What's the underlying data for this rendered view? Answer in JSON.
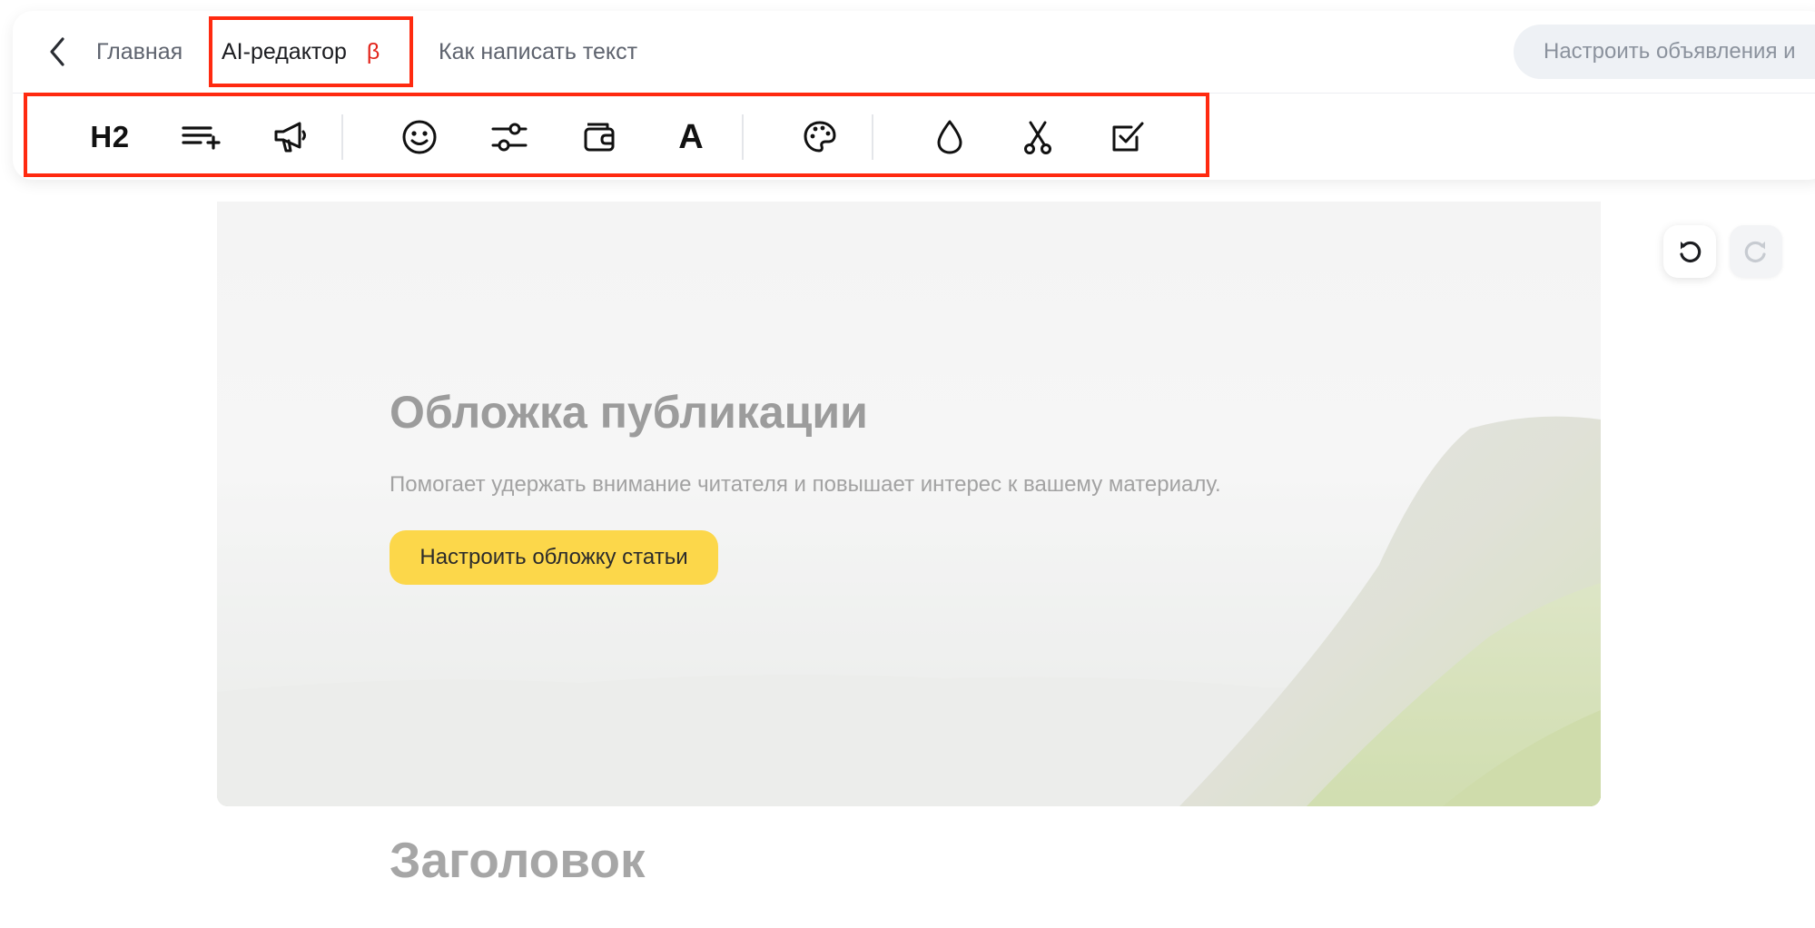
{
  "nav": {
    "home_label": "Главная",
    "editor_label": "AI-редактор",
    "beta_badge": "β",
    "guide_label": "Как написать текст",
    "setup_button": "Настроить объявления и"
  },
  "toolbar": {
    "groups": [
      [
        "heading-h2",
        "add-paragraph",
        "megaphone"
      ],
      [
        "emoji",
        "settings-sliders",
        "wallet",
        "font"
      ],
      [
        "palette"
      ],
      [
        "drop",
        "scissors",
        "checkbox"
      ]
    ],
    "h2_label": "H2",
    "font_label": "A"
  },
  "cover": {
    "title": "Обложка публикации",
    "subtitle": "Помогает удержать внимание читателя и повышает интерес к вашему материалу.",
    "button": "Настроить обложку статьи"
  },
  "editor": {
    "heading_placeholder": "Заголовок"
  },
  "colors": {
    "accent_button": "#fcd74a",
    "highlight_border": "#ff2a10",
    "beta": "#e2231a"
  }
}
